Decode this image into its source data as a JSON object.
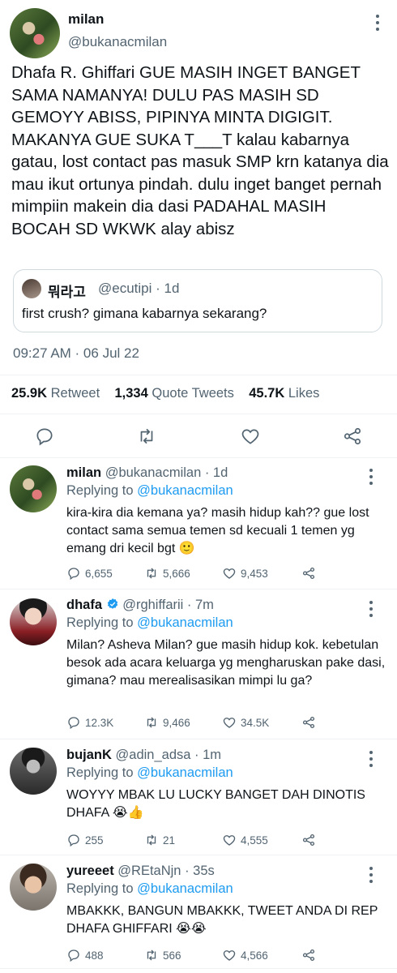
{
  "tweet": {
    "author_name": "milan",
    "author_handle": "@bukanacmilan",
    "text": "Dhafa R. Ghiffari GUE MASIH INGET BANGET SAMA NAMANYA! DULU PAS MASIH SD GEMOYY ABISS, PIPINYA MINTA DIGIGIT. MAKANYA GUE SUKA T___T kalau kabarnya gatau, lost contact pas masuk SMP krn katanya dia mau ikut ortunya pindah. dulu inget banget pernah mimpiin makein dia dasi PADAHAL MASIH BOCAH SD WKWK alay abisz",
    "quote": {
      "author_name": "뭐라고",
      "author_handle": "@ecutipi",
      "time": "· 1d",
      "text": "first crush? gimana kabarnya sekarang?"
    },
    "timestamp": "09:27 AM · 06 Jul 22",
    "stats": {
      "retweets": "25.9K",
      "retweets_label": "Retweet",
      "quotes": "1,334",
      "quotes_label": "Quote Tweets",
      "likes": "45.7K",
      "likes_label": "Likes"
    }
  },
  "replies": [
    {
      "name": "milan",
      "handle": "@bukanacmilan · 1d",
      "replying_prefix": "Replying to ",
      "replying_to": "@bukanacmilan",
      "text": "kira-kira dia kemana ya? masih hidup kah?? gue lost contact sama semua temen sd kecuali 1 temen yg emang dri kecil bgt 🙂",
      "replies": "6,655",
      "retweets": "5,666",
      "likes": "9,453"
    },
    {
      "name": "dhafa",
      "handle": "@rghiffarii · 7m",
      "replying_prefix": "Replying to ",
      "replying_to": "@bukanacmilan",
      "text": "Milan? Asheva Milan? gue masih hidup kok. kebetulan besok ada acara keluarga yg mengharuskan pake dasi, gimana? mau merealisasikan mimpi lu ga?",
      "replies": "12.3K",
      "retweets": "9,466",
      "likes": "34.5K"
    },
    {
      "name": "bujanK",
      "handle": "@adin_adsa · 1m",
      "replying_prefix": "Replying to ",
      "replying_to": "@bukanacmilan",
      "text": "WOYYY MBAK LU LUCKY BANGET DAH DINOTIS DHAFA 😭👍",
      "replies": "255",
      "retweets": "21",
      "likes": "4,555"
    },
    {
      "name": "yureeet",
      "handle": "@REtaNjn · 35s",
      "replying_prefix": "Replying to ",
      "replying_to": "@bukanacmilan",
      "text": "MBAKKK, BANGUN MBAKKK, TWEET ANDA DI REP DHAFA GHIFFARI 😭😭",
      "replies": "488",
      "retweets": "566",
      "likes": "4,566"
    }
  ],
  "icons": [
    "reply-icon",
    "retweet-icon",
    "like-icon",
    "share-icon",
    "more-icon",
    "verified-icon"
  ],
  "colors": {
    "accent": "#1d9bf0",
    "muted": "#536471",
    "text": "#0f1419",
    "divider": "#eff3f4"
  }
}
